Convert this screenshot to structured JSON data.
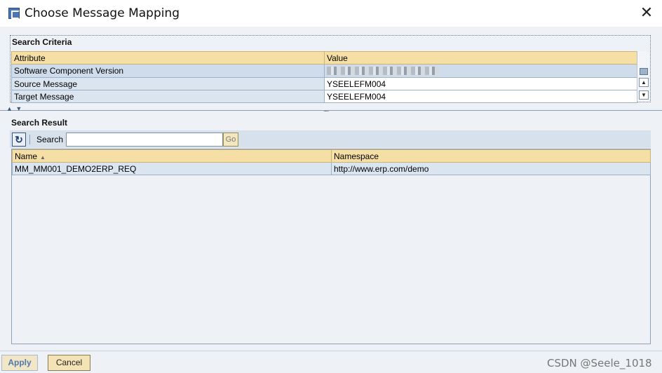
{
  "window": {
    "title": "Choose Message Mapping",
    "close_glyph": "✕"
  },
  "criteria": {
    "title": "Search Criteria",
    "columns": [
      "Attribute",
      "Value"
    ],
    "rows": [
      {
        "attribute": "Software Component Version",
        "value": ""
      },
      {
        "attribute": "Source Message",
        "value": "YSEELEFM004"
      },
      {
        "attribute": "Target Message",
        "value": "YSEELEFM004"
      }
    ]
  },
  "splitter": {
    "arrows": "▲ ▼",
    "grip": "......"
  },
  "result": {
    "title": "Search Result",
    "toolbar": {
      "refresh_icon": "refresh-icon",
      "search_label": "Search",
      "search_value": "",
      "go_label": "Go"
    },
    "columns": [
      "Name",
      "Namespace"
    ],
    "sort_glyph": "▲",
    "rows": [
      {
        "name": "MM_MM001_DEMO2ERP_REQ",
        "namespace": "http://www.erp.com/demo"
      }
    ]
  },
  "footer": {
    "apply_label": "Apply",
    "cancel_label": "Cancel",
    "watermark": "CSDN @Seele_1018"
  },
  "colors": {
    "header_bg": "#f5dfa4",
    "row_bg": "#dbe5f0",
    "client_bg": "#eef2f6",
    "button_bg": "#f4e4b5"
  }
}
